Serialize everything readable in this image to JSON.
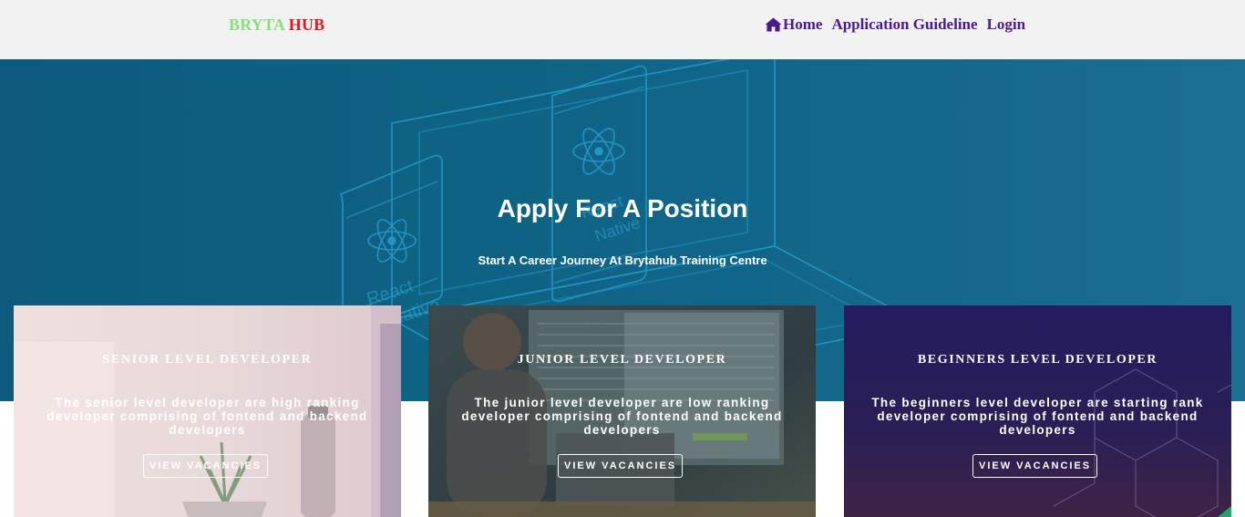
{
  "brand": {
    "part1": "BRYTA",
    "part2": "HUB"
  },
  "nav": {
    "home": "Home",
    "guideline": "Application Guideline",
    "login": "Login"
  },
  "hero": {
    "title": "Apply For A Position",
    "subtitle": "Start A Career Journey At Brytahub Training Centre",
    "art_text_1": "React",
    "art_text_2": "Native",
    "art_text_3": "React",
    "art_text_4": "Native"
  },
  "cards": [
    {
      "title": "SENIOR LEVEL DEVELOPER",
      "description": "The senior level developer are high ranking developer comprising of fontend and backend developers",
      "button": "VIEW VACANCIES"
    },
    {
      "title": "JUNIOR LEVEL DEVELOPER",
      "description": "The junior level developer are low ranking developer comprising of fontend and backend developers",
      "button": "VIEW VACANCIES"
    },
    {
      "title": "BEGINNERS LEVEL DEVELOPER",
      "description": "The beginners level developer are starting rank developer comprising of fontend and backend developers",
      "button": "VIEW VACANCIES"
    }
  ],
  "colors": {
    "brand_green": "#86e07c",
    "brand_red": "#e8141e",
    "nav_purple": "#4b1a8a",
    "hero_blue": "#0e6283"
  }
}
